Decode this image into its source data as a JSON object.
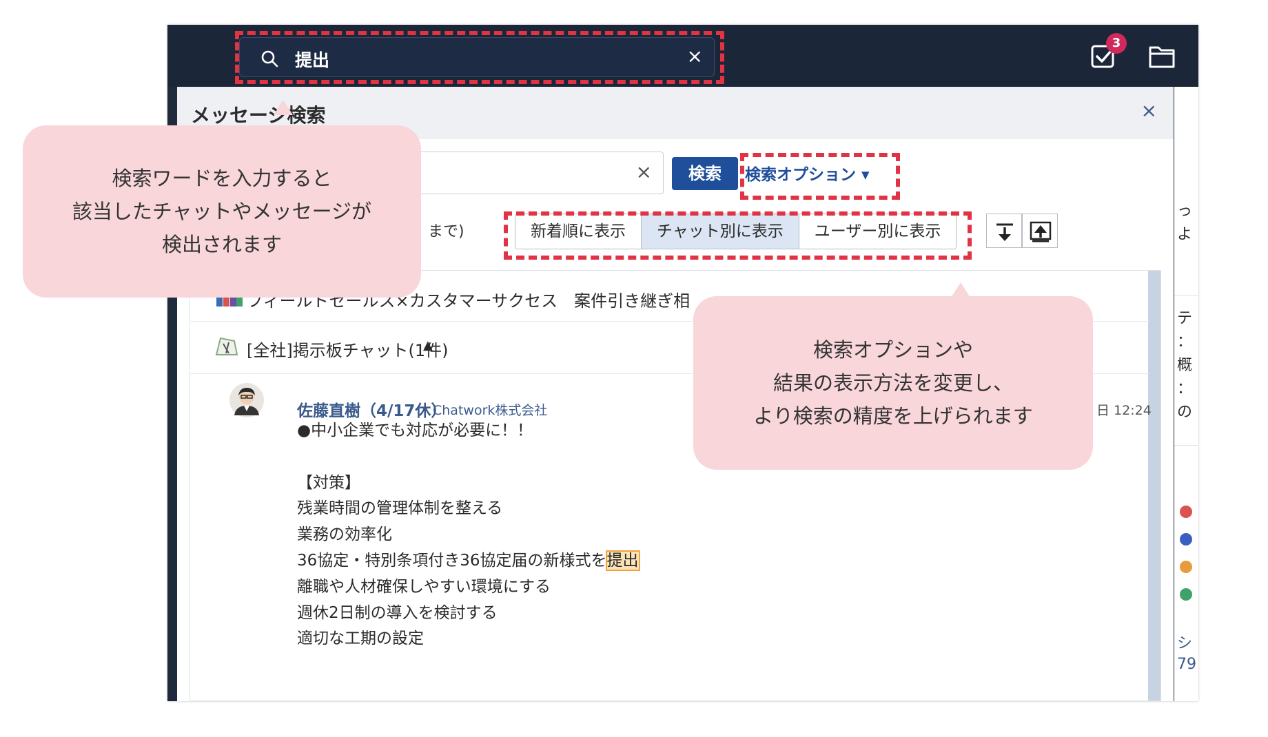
{
  "header": {
    "search_value": "提出",
    "clear_icon": "×",
    "task_badge_count": "3"
  },
  "modal": {
    "title": "メッセージ検索",
    "close": "×",
    "query_clear": "×",
    "search_button": "検索",
    "options_link": "検索オプション ▾",
    "date_range_fragment": "まで)",
    "view_modes": [
      "新着順に表示",
      "チャット別に表示",
      "ユーザー別に表示"
    ],
    "active_view_mode": "チャット別に表示"
  },
  "results": {
    "chats": [
      {
        "name": "フィールドセールス×カスタマーサクセス　案件引き継ぎ相"
      },
      {
        "name": "[全社]掲示板チャット(1件)",
        "toggle": "▲"
      }
    ],
    "message": {
      "sender": "佐藤直樹（4/17休）",
      "company": "Chatwork株式会社",
      "time": "日 12:24",
      "lines_before": "●中小企業でも対応が必要に！！\n\n【対策】\n残業時間の管理体制を整える\n業務の効率化\n36協定・特別条項付き36協定届の新様式を",
      "highlight": "提出",
      "lines_after": "\n離職や人材確保しやすい環境にする\n週休2日制の導入を検討する\n適切な工期の設定"
    }
  },
  "peek": {
    "fragments": [
      "っ",
      "よ",
      "テ",
      "：",
      "概",
      "：",
      "の",
      "シ",
      "79"
    ]
  },
  "callouts": {
    "left": "検索ワードを入力すると\n該当したチャットやメッセージが\n検出されます",
    "right": "検索オプションや\n結果の表示方法を変更し、\nより検索の精度を上げられます"
  },
  "colors": {
    "topbar": "#1b2639",
    "accent": "#1f4e9b",
    "badge": "#d0295b",
    "annotation_dash": "#e03344",
    "callout_bg": "#f8d6da",
    "highlight": "#fbe3b8"
  },
  "icons": [
    "search-icon",
    "clear-icon",
    "task-icon",
    "folder-icon",
    "expand-all-icon",
    "collapse-all-icon",
    "close-icon"
  ]
}
